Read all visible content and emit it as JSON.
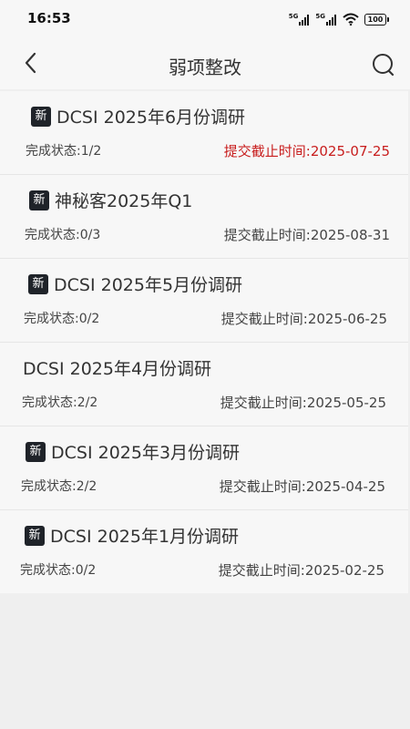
{
  "status_bar": {
    "time": "16:53",
    "signal_1_label": "5G",
    "signal_2_label": "5G",
    "battery": "100"
  },
  "header": {
    "title": "弱项整改",
    "back_icon": "back-arrow-icon",
    "search_icon": "search-icon"
  },
  "colors": {
    "overdue": "#c81e1e",
    "badge_bg": "#1f2329",
    "page_bg": "#efefef",
    "card_bg": "#f7f7f7"
  },
  "items": [
    {
      "is_new": true,
      "badge": "新",
      "title": "DCSI 2025年6月份调研",
      "status": "完成状态:1/2",
      "deadline": "提交截止时间:2025-07-25",
      "overdue": true
    },
    {
      "is_new": true,
      "badge": "新",
      "title": "神秘客2025年Q1",
      "status": "完成状态:0/3",
      "deadline": "提交截止时间:2025-08-31",
      "overdue": false
    },
    {
      "is_new": true,
      "badge": "新",
      "title": "DCSI 2025年5月份调研",
      "status": "完成状态:0/2",
      "deadline": "提交截止时间:2025-06-25",
      "overdue": false
    },
    {
      "is_new": false,
      "badge": "",
      "title": "DCSI 2025年4月份调研",
      "status": "完成状态:2/2",
      "deadline": "提交截止时间:2025-05-25",
      "overdue": false
    },
    {
      "is_new": true,
      "badge": "新",
      "title": "DCSI 2025年3月份调研",
      "status": "完成状态:2/2",
      "deadline": "提交截止时间:2025-04-25",
      "overdue": false
    },
    {
      "is_new": true,
      "badge": "新",
      "title": "DCSI 2025年1月份调研",
      "status": "完成状态:0/2",
      "deadline": "提交截止时间:2025-02-25",
      "overdue": false
    }
  ]
}
